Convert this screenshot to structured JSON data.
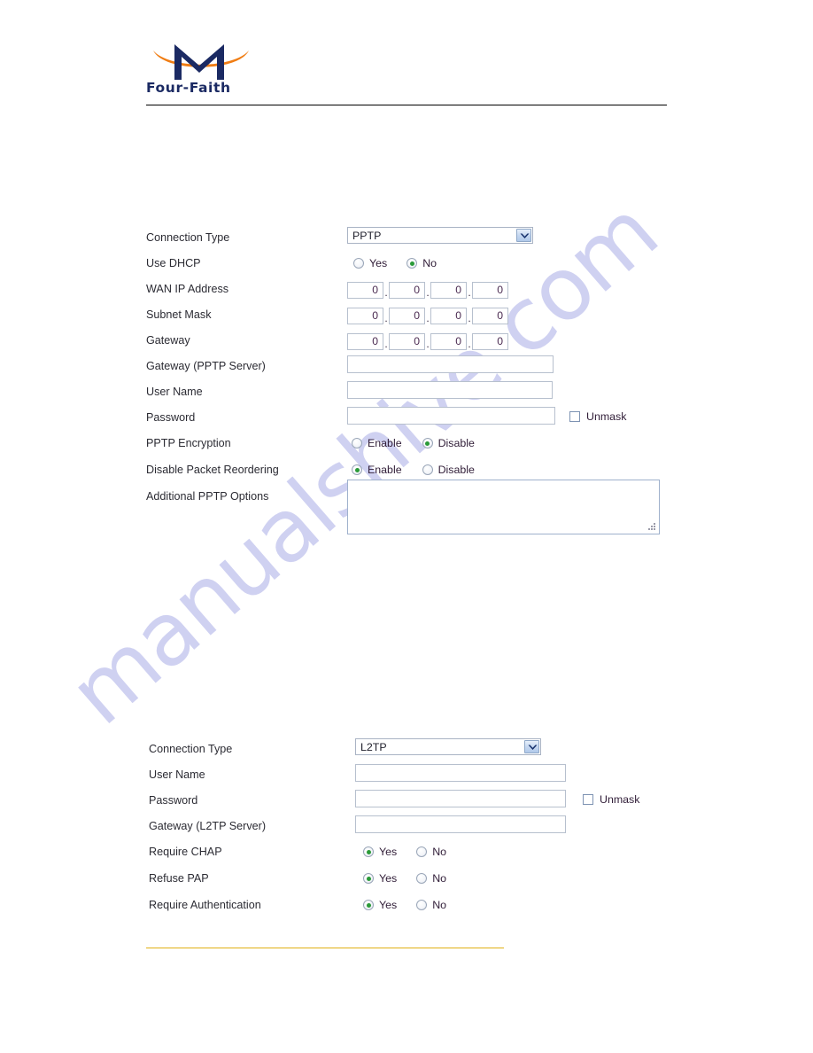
{
  "brand": {
    "wordmark": "Four-Faith",
    "logo_icon": "four-faith-m-logo",
    "logo_navy": "#1b2a63",
    "logo_orange": "#f07d14"
  },
  "watermark": {
    "text": "manualshive.com",
    "color": "#c7c9ef"
  },
  "theme": {
    "label_color": "#2b2b33",
    "value_color": "#20202c",
    "radio_on_color": "#2a9a38",
    "input_border": "#b7c0ce",
    "footer_rule_color": "#e0b014",
    "header_rule_color": "#000000"
  },
  "pptp_section": {
    "rows": [
      {
        "label": "Connection Type",
        "type": "select",
        "value": "PPTP",
        "options": [
          "PPTP"
        ]
      },
      {
        "label": "Use DHCP",
        "type": "radio",
        "options": [
          "Yes",
          "No"
        ],
        "selected": "No"
      },
      {
        "label": "WAN IP Address",
        "type": "octets",
        "value": [
          "0",
          "0",
          "0",
          "0"
        ]
      },
      {
        "label": "Subnet Mask",
        "type": "octets",
        "value": [
          "0",
          "0",
          "0",
          "0"
        ]
      },
      {
        "label": "Gateway",
        "type": "octets",
        "value": [
          "0",
          "0",
          "0",
          "0"
        ]
      },
      {
        "label": "Gateway (PPTP Server)",
        "type": "text",
        "value": "",
        "placeholder": ""
      },
      {
        "label": "User Name",
        "type": "text",
        "value": "",
        "placeholder": ""
      },
      {
        "label": "Password",
        "type": "password",
        "value": "",
        "placeholder": "",
        "checkbox_label": "Unmask",
        "checkbox_checked": false
      },
      {
        "label": "PPTP Encryption",
        "type": "radio",
        "options": [
          "Enable",
          "Disable"
        ],
        "selected": "Disable"
      },
      {
        "label": "Disable Packet Reordering",
        "type": "radio",
        "options": [
          "Enable",
          "Disable"
        ],
        "selected": "Enable"
      },
      {
        "label": "Additional PPTP Options",
        "type": "textarea",
        "value": "",
        "placeholder": ""
      }
    ]
  },
  "l2tp_section": {
    "rows": [
      {
        "label": "Connection Type",
        "type": "select",
        "value": "L2TP",
        "options": [
          "L2TP"
        ]
      },
      {
        "label": "User Name",
        "type": "text",
        "value": "",
        "placeholder": ""
      },
      {
        "label": "Password",
        "type": "password",
        "value": "",
        "placeholder": "",
        "checkbox_label": "Unmask",
        "checkbox_checked": false
      },
      {
        "label": "Gateway (L2TP Server)",
        "type": "text",
        "value": "",
        "placeholder": ""
      },
      {
        "label": "Require CHAP",
        "type": "radio",
        "options": [
          "Yes",
          "No"
        ],
        "selected": "Yes"
      },
      {
        "label": "Refuse PAP",
        "type": "radio",
        "options": [
          "Yes",
          "No"
        ],
        "selected": "Yes"
      },
      {
        "label": "Require Authentication",
        "type": "radio",
        "options": [
          "Yes",
          "No"
        ],
        "selected": "Yes"
      }
    ]
  }
}
